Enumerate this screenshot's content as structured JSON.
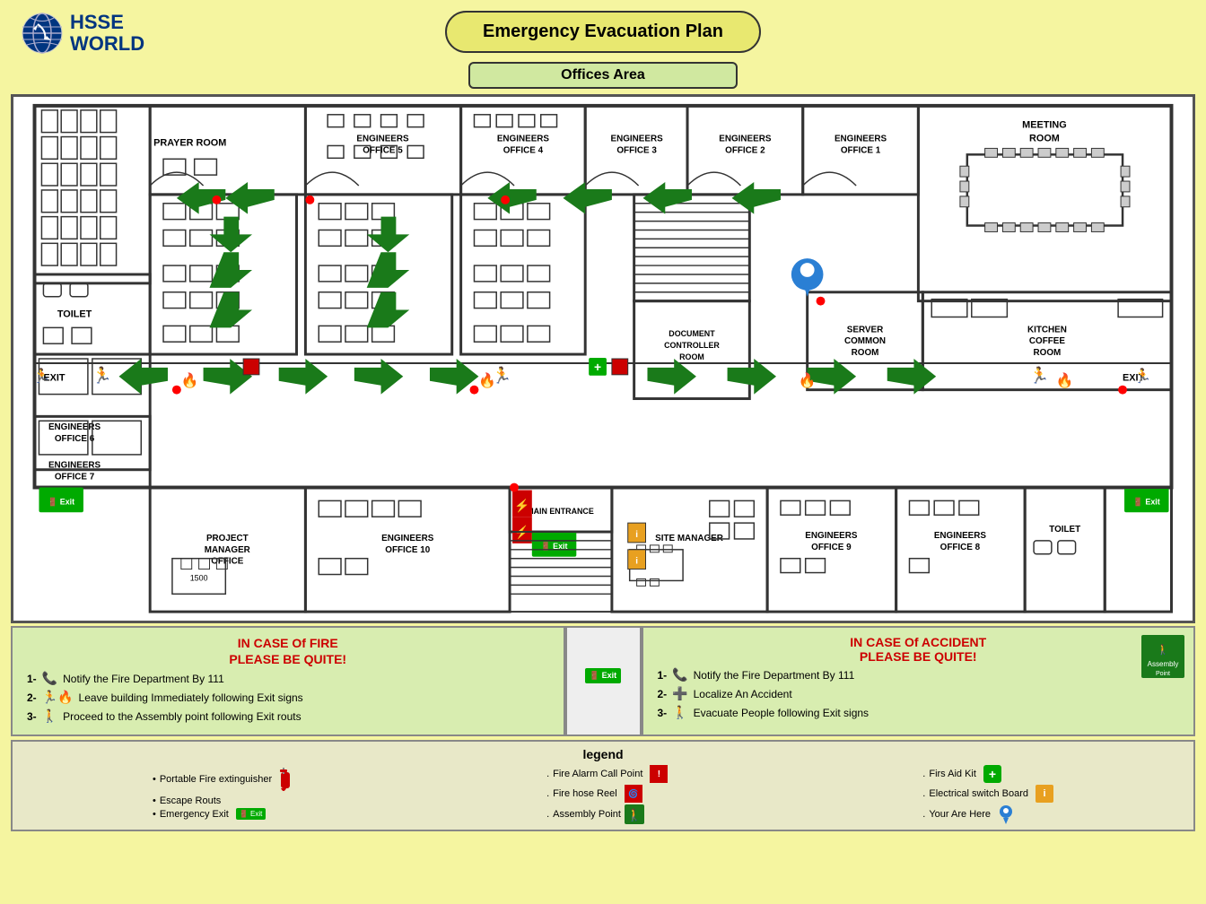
{
  "header": {
    "title": "Emergency  Evacuation Plan",
    "subtitle": "Offices Area",
    "logo_text_line1": "HSSE",
    "logo_text_line2": "WORLD"
  },
  "rooms": [
    {
      "id": "prayer_room",
      "label": "PRAYER ROOM"
    },
    {
      "id": "engineers_office_5",
      "label": "ENGINEERS\nOFFICE 5"
    },
    {
      "id": "engineers_office_4",
      "label": "ENGINEERS\nOFFICE 4"
    },
    {
      "id": "engineers_office_3",
      "label": "ENGINEERS\nOFFICE 3"
    },
    {
      "id": "engineers_office_2",
      "label": "ENGINEERS\nOFFICE 2"
    },
    {
      "id": "engineers_office_1",
      "label": "ENGINEERS\nOFFICE 1"
    },
    {
      "id": "meeting_room",
      "label": "MEETING\nROOM"
    },
    {
      "id": "toilet_top",
      "label": "TOILET"
    },
    {
      "id": "engineers_office_6",
      "label": "ENGINEERS\nOFFICE 6"
    },
    {
      "id": "engineers_office_7",
      "label": "ENGINEERS\nOFFICE 7"
    },
    {
      "id": "document_controller",
      "label": "DOCUMENT\nCONTROLLER\nROOM"
    },
    {
      "id": "server_common",
      "label": "SERVER\nCOMMON\nROOM"
    },
    {
      "id": "kitchen_coffee",
      "label": "KITCHEN\nCOFFEE\nROOM"
    },
    {
      "id": "project_manager",
      "label": "PROJECT\nMANAGER\nOFFICE"
    },
    {
      "id": "engineers_office_10",
      "label": "ENGINEERS\nOFFICE 10"
    },
    {
      "id": "main_entrance",
      "label": "MAIN ENTRANCE"
    },
    {
      "id": "site_manager",
      "label": "SITE MANAGER"
    },
    {
      "id": "engineers_office_9",
      "label": "ENGINEERS\nOFFICE 9"
    },
    {
      "id": "engineers_office_8",
      "label": "ENGINEERS\nOFFICE 8"
    },
    {
      "id": "toilet_bottom",
      "label": "TOILET"
    }
  ],
  "fire_instructions": {
    "title_line1": "IN CASE Of FIRE",
    "title_line2": "PLEASE BE QUITE!",
    "items": [
      {
        "num": "1-",
        "text": "Notify the Fire Department By 111"
      },
      {
        "num": "2-",
        "text": "Leave building Immediately following  Exit signs"
      },
      {
        "num": "3-",
        "text": "Proceed to the Assembly point  following Exit routs"
      }
    ]
  },
  "accident_instructions": {
    "title_line1": "IN CASE Of ACCIDENT",
    "title_line2": "PLEASE BE QUITE!",
    "items": [
      {
        "num": "1-",
        "text": "Notify the Fire Department By 111"
      },
      {
        "num": "2-",
        "text": "Localize An Accident"
      },
      {
        "num": "3-",
        "text": "Evacuate People following Exit signs"
      }
    ]
  },
  "legend": {
    "title": "legend",
    "col1": [
      {
        "bullet": "•",
        "label": "Portable Fire extinguisher"
      },
      {
        "bullet": "•",
        "label": "Escape Routs"
      },
      {
        "bullet": "•",
        "label": "Emergency Exit"
      }
    ],
    "col2": [
      {
        "dot": ".",
        "label": "Fire Alarm Call Point"
      },
      {
        "dot": ".",
        "label": "Fire hose Reel"
      },
      {
        "dot": ".",
        "label": "Assembly Point"
      }
    ],
    "col3": [
      {
        "dot": ".",
        "label": "Firs Aid Kit"
      },
      {
        "dot": ".",
        "label": "Electrical switch Board"
      },
      {
        "dot": ".",
        "label": "Your Are Here"
      }
    ]
  },
  "exits": [
    "EXIT",
    "EXIT"
  ],
  "colors": {
    "background": "#f5f5a0",
    "floor_bg": "#ffffff",
    "title_oval": "#e8e870",
    "subtitle_box": "#d0e8a0",
    "legend_box": "#e8e8c8",
    "instructions_bg": "#d8edb0",
    "arrow_green": "#1a7a1a",
    "fire_text": "#cc0000",
    "logo_blue": "#003580"
  }
}
